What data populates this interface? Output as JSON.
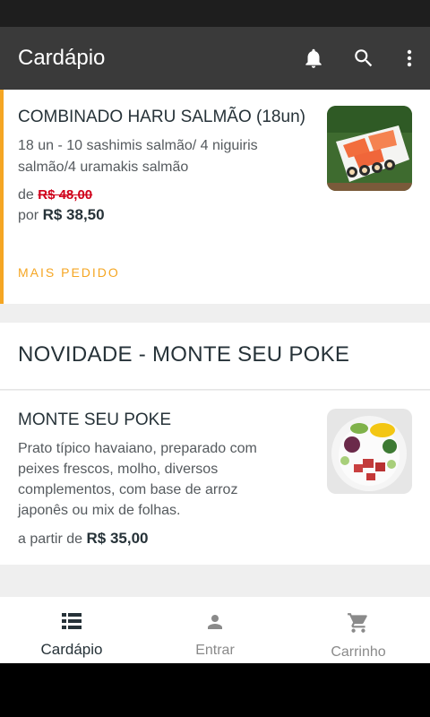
{
  "app_bar": {
    "title": "Cardápio",
    "icons": [
      "bell-icon",
      "search-icon",
      "more-vert-icon"
    ]
  },
  "featured": {
    "title": "COMBINADO HARU SALMÃO (18un)",
    "description_line1": "18 un - 10 sashimis salmão/ 4 niguiris",
    "description_line2": "salmão/4 uramakis salmão",
    "from_label": "de",
    "old_price": "R$ 48,00",
    "by_label": "por",
    "new_price": "R$ 38,50",
    "badge": "MAIS PEDIDO",
    "accent_color": "#f5a623"
  },
  "section": {
    "title": "NOVIDADE - MONTE SEU POKE"
  },
  "item": {
    "title": "MONTE SEU POKE",
    "description_line1": "Prato típico havaiano, preparado com",
    "description_line2": "peixes frescos, molho, diversos",
    "description_line3": "complementos, com base de arroz",
    "description_line4": "japonês ou mix de folhas.",
    "from_label": "a partir de",
    "price": "R$ 35,00"
  },
  "bottom_nav": [
    {
      "label": "Cardápio",
      "icon": "menu-list-icon",
      "active": true
    },
    {
      "label": "Entrar",
      "icon": "person-icon",
      "active": false
    },
    {
      "label": "Carrinho",
      "icon": "cart-icon",
      "active": false
    }
  ]
}
